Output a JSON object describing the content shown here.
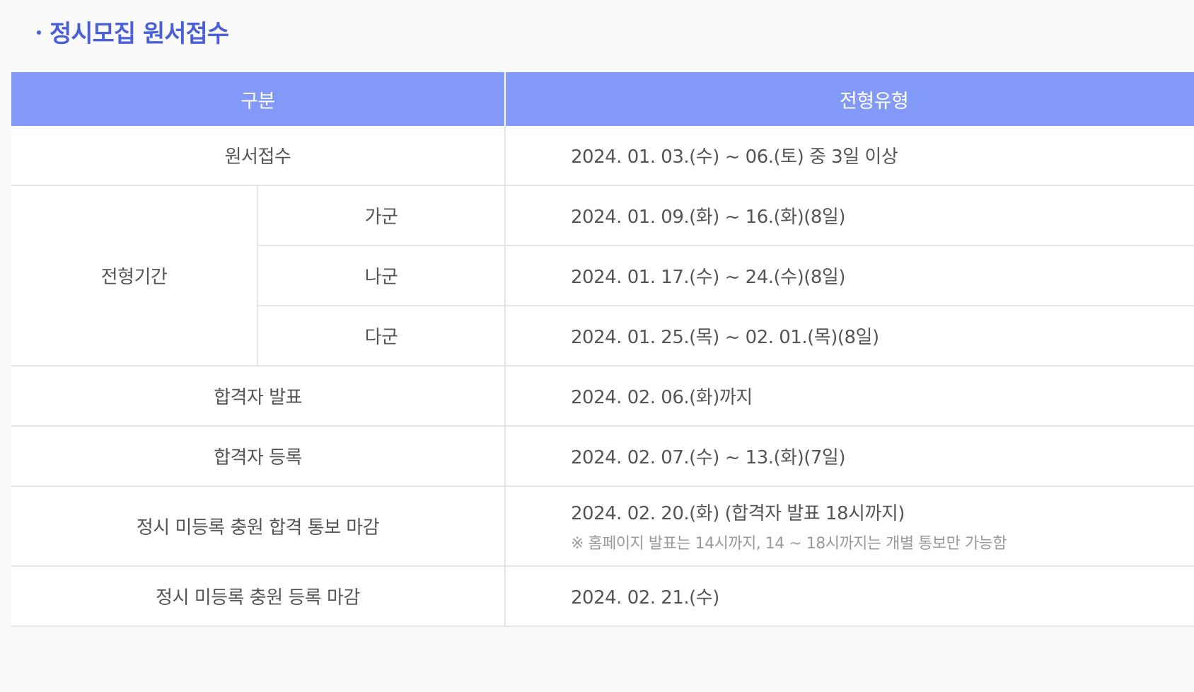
{
  "section": {
    "title": "정시모집 원서접수"
  },
  "table": {
    "headers": {
      "category": "구분",
      "type": "전형유형"
    },
    "rows": [
      {
        "label": "원서접수",
        "value": "2024. 01. 03.(수) ~ 06.(토) 중 3일 이상"
      },
      {
        "group": "전형기간",
        "label": "가군",
        "value": "2024. 01. 09.(화) ~ 16.(화)(8일)"
      },
      {
        "label": "나군",
        "value": "2024. 01. 17.(수) ~ 24.(수)(8일)"
      },
      {
        "label": "다군",
        "value": "2024. 01. 25.(목) ~ 02. 01.(목)(8일)"
      },
      {
        "label": "합격자 발표",
        "value": "2024. 02. 06.(화)까지"
      },
      {
        "label": "합격자 등록",
        "value": "2024. 02. 07.(수) ~ 13.(화)(7일)"
      },
      {
        "label": "정시 미등록 충원 합격 통보 마감",
        "value": "2024. 02. 20.(화) (합격자 발표 18시까지)",
        "note": "※ 홈페이지 발표는 14시까지, 14 ~ 18시까지는 개별 통보만 가능함"
      },
      {
        "label": "정시 미등록 충원 등록 마감",
        "value": "2024. 02. 21.(수)"
      }
    ]
  }
}
